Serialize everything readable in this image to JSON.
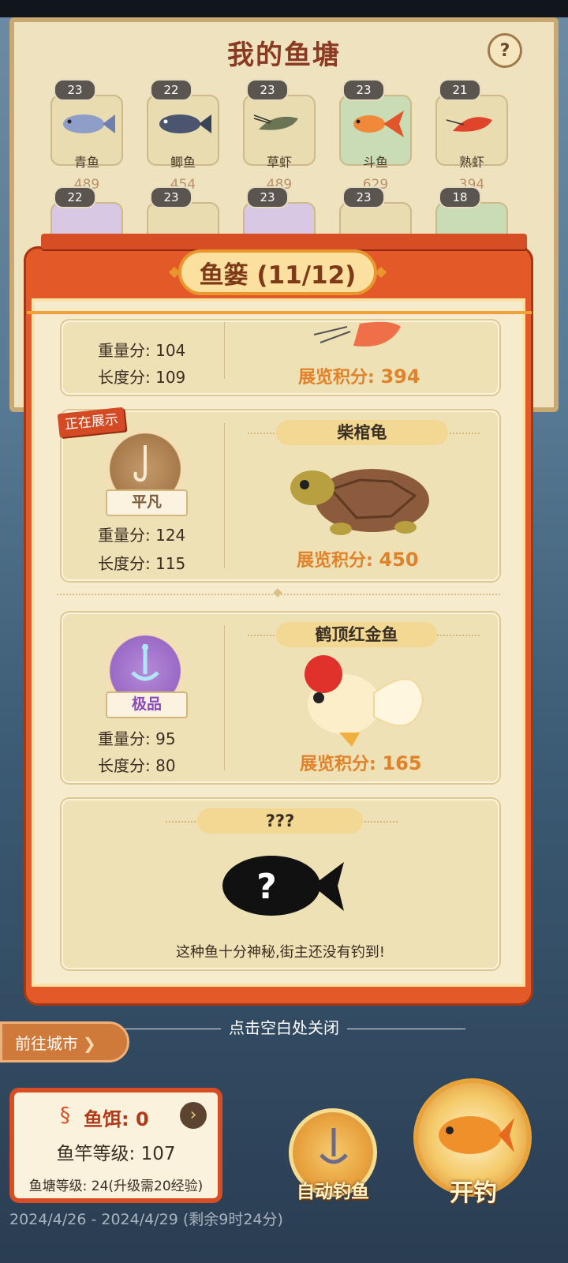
{
  "pond": {
    "title": "我的鱼塘",
    "help": "?",
    "row1": [
      {
        "level": "23",
        "name": "青鱼",
        "score": "489"
      },
      {
        "level": "22",
        "name": "鲫鱼",
        "score": "454"
      },
      {
        "level": "23",
        "name": "草虾",
        "score": "489"
      },
      {
        "level": "23",
        "name": "斗鱼",
        "score": "629"
      },
      {
        "level": "21",
        "name": "熟虾",
        "score": "394"
      }
    ],
    "row2": [
      {
        "level": "22"
      },
      {
        "level": "23"
      },
      {
        "level": "23"
      },
      {
        "level": "23"
      },
      {
        "level": "18"
      }
    ]
  },
  "creel": {
    "title": "鱼篓 (11/12)",
    "showing_tag": "正在展示",
    "cards": [
      {
        "weight": "重量分: 104",
        "length": "长度分: 109",
        "expo_label": "展览积分:",
        "expo_value": "394"
      },
      {
        "grade": "平凡",
        "weight": "重量分: 124",
        "length": "长度分: 115",
        "fish_name": "柴棺龟",
        "expo_label": "展览积分:",
        "expo_value": "450"
      },
      {
        "grade": "极品",
        "weight": "重量分: 95",
        "length": "长度分: 80",
        "fish_name": "鹤顶红金鱼",
        "expo_label": "展览积分:",
        "expo_value": "165"
      },
      {
        "fish_name": "???",
        "mystery_text": "这种鱼十分神秘,街主还没有钓到!"
      }
    ]
  },
  "hud": {
    "close_hint": "点击空白处关闭",
    "goto_city": "前往城市",
    "bait": "鱼饵: 0",
    "rod_level": "鱼竿等级: 107",
    "pond_level": "鱼塘等级: 24(升级需20经验)",
    "auto_fish": "自动钓鱼",
    "cast": "开钓",
    "date_range": "2024/4/26 - 2024/4/29 (剩余9时24分)"
  },
  "colors": {
    "accent": "#e35a28",
    "gold": "#e0822c",
    "paper": "#f6ebcc"
  }
}
